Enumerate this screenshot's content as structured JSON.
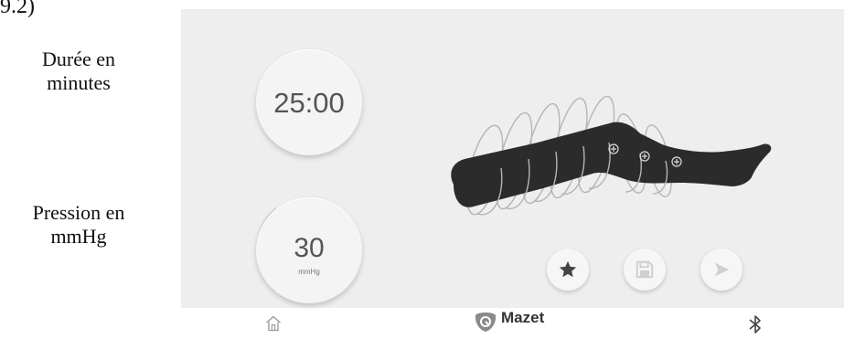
{
  "corner_fragment": "9.2)",
  "captions": {
    "duration": [
      "Durée en",
      "minutes"
    ],
    "pressure": [
      "Pression en",
      "mmHg"
    ]
  },
  "dials": {
    "duration": {
      "value": "25:00"
    },
    "pressure": {
      "value": "30",
      "unit": "mmHg"
    }
  },
  "actions": {
    "favorite_icon": "star-icon",
    "save_icon": "floppy-disk-icon",
    "start_icon": "play-icon"
  },
  "bottom_bar": {
    "home_icon": "home-icon",
    "brand": "Mazet",
    "bluetooth_icon": "bluetooth-icon"
  },
  "colors": {
    "panel_bg": "#eeeeee",
    "leg_fill": "#2b2b2b",
    "ring_stroke": "#b5b5b5",
    "icon_gray": "#cfcfcf",
    "star_dark": "#444444",
    "logo_gray": "#8a8a8a"
  }
}
